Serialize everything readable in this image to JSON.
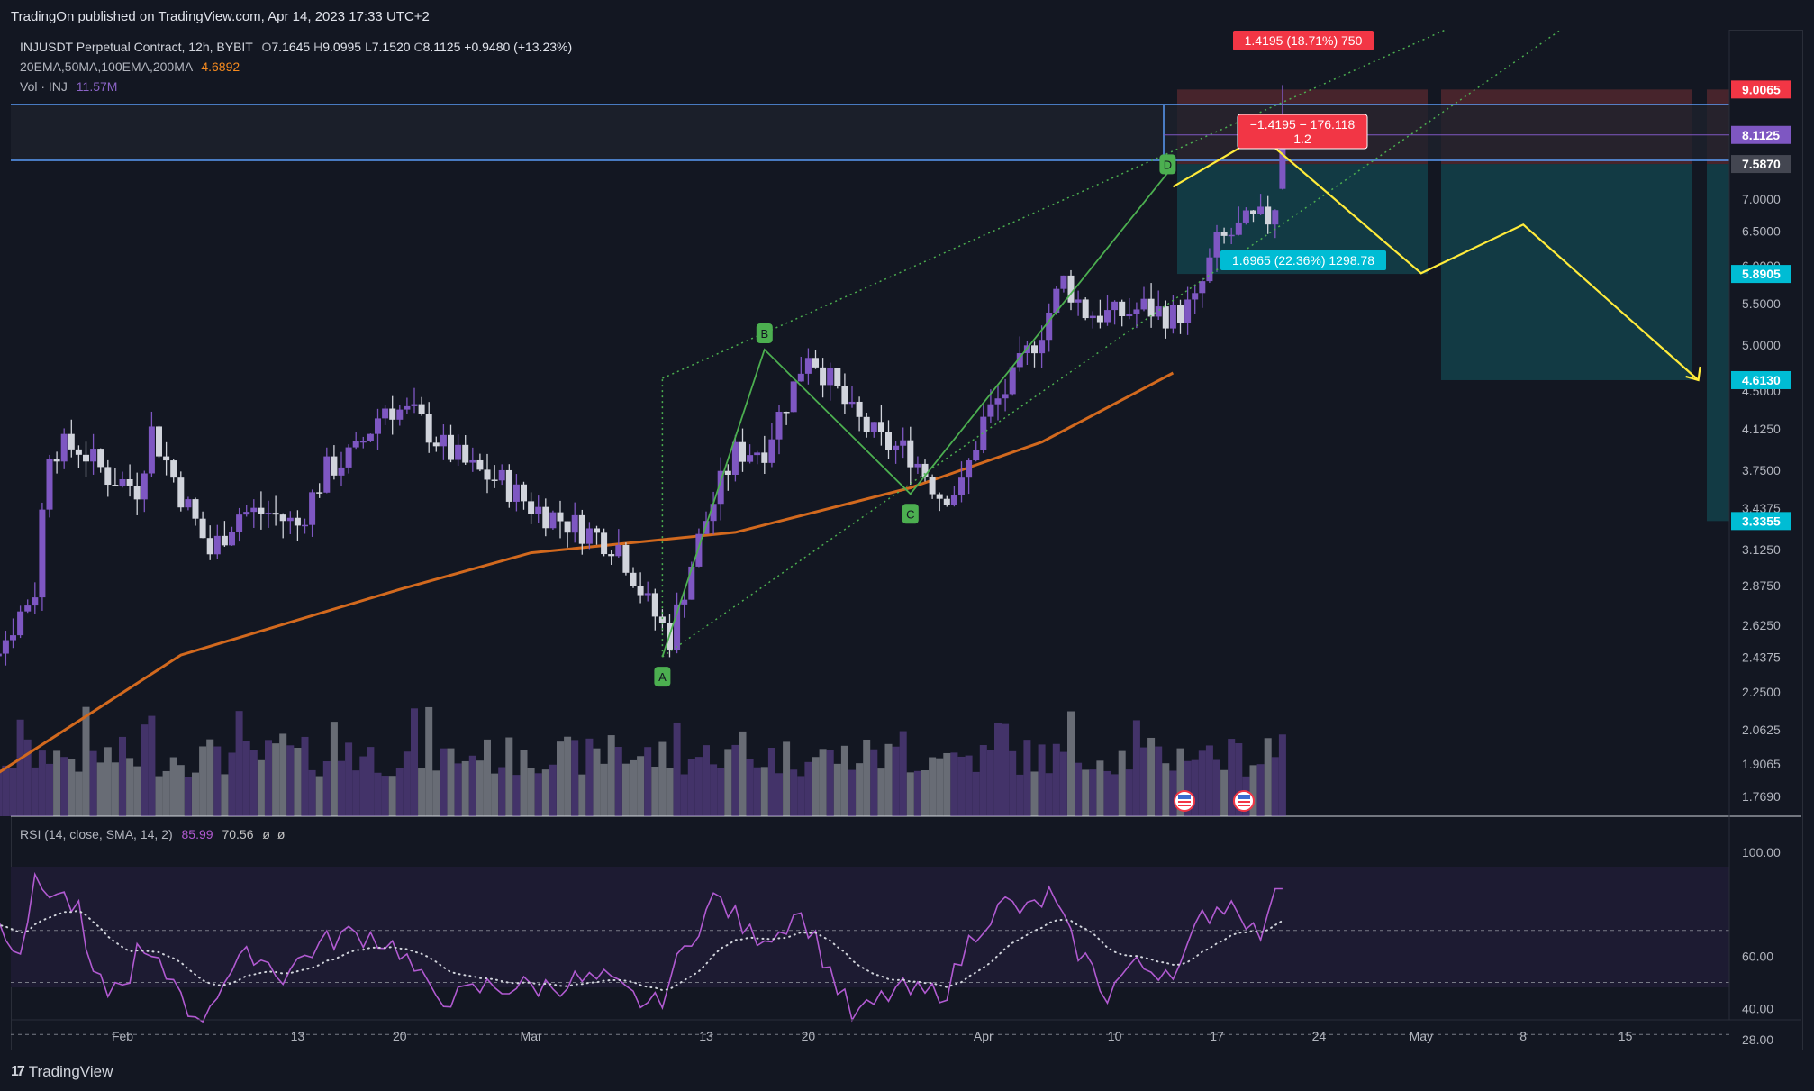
{
  "header": {
    "published": "TradingOn published on TradingView.com, Apr 14, 2023 17:33 UTC+2"
  },
  "legend": {
    "symbol": "INJUSDT Perpetual Contract, 12h, BYBIT",
    "o_label": "O",
    "o": "7.1645",
    "h_label": "H",
    "h": "9.0995",
    "l_label": "L",
    "l": "7.1520",
    "c_label": "C",
    "c": "8.1125",
    "change": "+0.9480 (+13.23%)",
    "ma_label": "20EMA,50MA,100EMA,200MA",
    "ma_value": "4.6892",
    "vol_label": "Vol · INJ",
    "vol_value": "11.57M"
  },
  "rsi_legend": {
    "label": "RSI (14, close, SMA, 14, 2)",
    "v1": "85.99",
    "v2": "70.56",
    "v3": "ø",
    "v4": "ø"
  },
  "branding": {
    "logo_mark": "17",
    "name": "TradingView"
  },
  "price_scale": {
    "tick_labels": [
      "7.0000",
      "6.5000",
      "6.0000",
      "5.5000",
      "5.0000",
      "4.5000",
      "4.1250",
      "3.7500",
      "3.4375",
      "3.1250",
      "2.8750",
      "2.6250",
      "2.4375",
      "2.2500",
      "2.0625",
      "1.9065",
      "1.7690"
    ],
    "badges": [
      {
        "text": "9.0065",
        "bg": "#f23645"
      },
      {
        "text": "8.1125",
        "bg": "#7e57c2"
      },
      {
        "text": "7.5870",
        "bg": "#434651"
      },
      {
        "text": "5.8905",
        "bg": "#00bcd4"
      },
      {
        "text": "4.6130",
        "bg": "#00bcd4"
      },
      {
        "text": "3.3355",
        "bg": "#00bcd4"
      }
    ]
  },
  "rsi_scale": {
    "tick_labels": [
      "100.00",
      "60.00",
      "40.00",
      "28.00"
    ]
  },
  "time_axis": {
    "labels": [
      "Feb",
      "13",
      "20",
      "Mar",
      "13",
      "20",
      "Apr",
      "10",
      "17",
      "24",
      "May",
      "8",
      "15"
    ]
  },
  "annotations": {
    "wave_labels": [
      "A",
      "B",
      "C",
      "D"
    ],
    "stop_label": "1.4195 (18.71%) 750",
    "target_label": "1.6965 (22.36%) 1298.78",
    "rr_line1": "−1.4195 − 176.118",
    "rr_line2": "1.2"
  },
  "colors": {
    "background": "#131722",
    "up_candle": "#7e57c2",
    "down_candle": "#d1d4dc",
    "ma_line": "#d2691e",
    "pattern": "#4caf50",
    "projection": "#ffeb3b",
    "rsi": "#b15ad1",
    "stop_zone": "#5a2a30",
    "target_zone": "#13414a"
  },
  "chart_data": {
    "type": "candlestick",
    "title": "INJUSDT Perpetual Contract, 12h, BYBIT",
    "ylim": [
      1.769,
      9.2
    ],
    "y_scale": "log",
    "grid": false,
    "last_close": 8.1125,
    "last_open": 7.1645,
    "last_high": 9.0995,
    "last_low": 7.152,
    "abcd_points": [
      {
        "label": "A",
        "date": "2023-03-10",
        "price": 2.44
      },
      {
        "label": "B",
        "date": "2023-03-17",
        "price": 4.95
      },
      {
        "label": "C",
        "date": "2023-03-27",
        "price": 3.55
      },
      {
        "label": "D",
        "date": "2023-04-14",
        "price": 7.55
      }
    ],
    "ma_4_6892_approx": [
      {
        "date": "2023-01-21",
        "value": 1.77
      },
      {
        "date": "2023-02-05",
        "value": 2.45
      },
      {
        "date": "2023-02-20",
        "value": 2.85
      },
      {
        "date": "2023-03-01",
        "value": 3.1
      },
      {
        "date": "2023-03-15",
        "value": 3.25
      },
      {
        "date": "2023-03-27",
        "value": 3.6
      },
      {
        "date": "2023-04-05",
        "value": 4.0
      },
      {
        "date": "2023-04-14",
        "value": 4.69
      }
    ],
    "position_tool": {
      "entry": 7.587,
      "stop": 9.0065,
      "target": 5.8905,
      "stop_text": "1.4195 (18.71%) 750",
      "target_text": "1.6965 (22.36%) 1298.78",
      "risk_reward": "1.2"
    },
    "second_zone": {
      "stop": 9.0065,
      "entry": 7.587,
      "target": 4.613,
      "far_target": 3.3355
    },
    "projection_path": [
      {
        "date": "2023-04-14",
        "price": 7.2
      },
      {
        "date": "2023-04-20",
        "price": 8.1
      },
      {
        "date": "2023-05-01",
        "price": 5.9
      },
      {
        "date": "2023-05-08",
        "price": 6.6
      },
      {
        "date": "2023-05-20",
        "price": 4.613
      }
    ],
    "rsi": {
      "last": 85.99,
      "sma": 70.56,
      "bands": [
        70,
        50,
        30
      ]
    }
  }
}
